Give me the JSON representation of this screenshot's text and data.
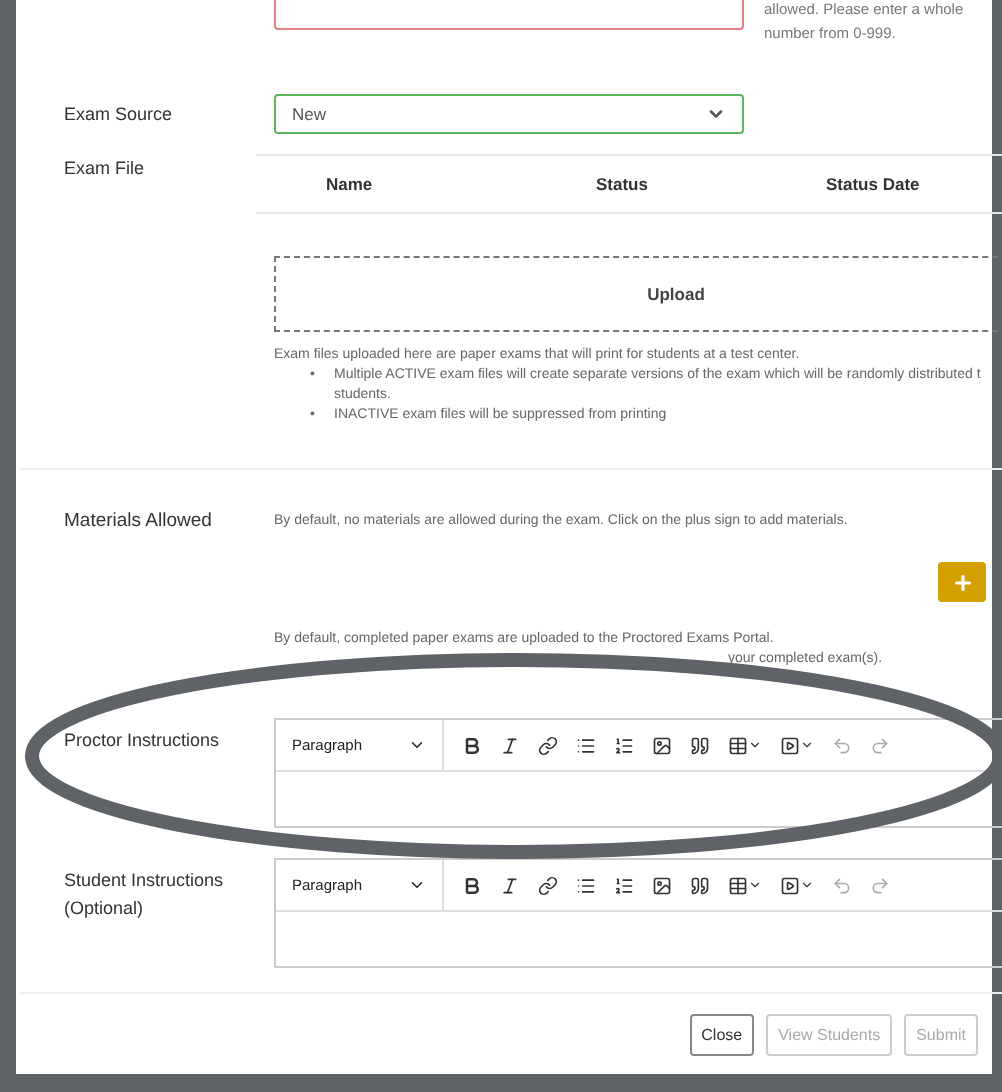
{
  "duration": {
    "invalid": true,
    "help": "allowed. Please enter a whole number from 0-999."
  },
  "exam_source": {
    "label": "Exam Source",
    "value": "New",
    "valid": true
  },
  "exam_file": {
    "label": "Exam File",
    "columns": [
      "Name",
      "Status",
      "Status Date"
    ],
    "upload": "Upload",
    "note": "Exam files uploaded here are paper exams that will print for students at a test center.",
    "bullets": [
      {
        "marker": "•",
        "text": "Multiple ACTIVE exam files will create separate versions of the exam which will be randomly distributed t"
      },
      {
        "text": "students."
      },
      {
        "marker": "•",
        "text": "INACTIVE exam files will be suppressed from printing"
      }
    ]
  },
  "materials": {
    "label": "Materials Allowed",
    "note": "By default, no materials are allowed during the exam. Click on the plus sign to add materials."
  },
  "completed_note": {
    "line_1": "By default, completed paper exams are uploaded to the Proctored Exams Portal.",
    "line_2": "your completed exam(s)."
  },
  "editors": [
    {
      "label": "Proctor Instructions",
      "format": "Paragraph"
    },
    {
      "label": "Student Instructions (Optional)",
      "format": "Paragraph"
    }
  ],
  "buttons": [
    {
      "label": "Close",
      "disabled": false
    },
    {
      "label": "View Students",
      "disabled": true
    },
    {
      "label": "Submit",
      "disabled": true
    }
  ]
}
